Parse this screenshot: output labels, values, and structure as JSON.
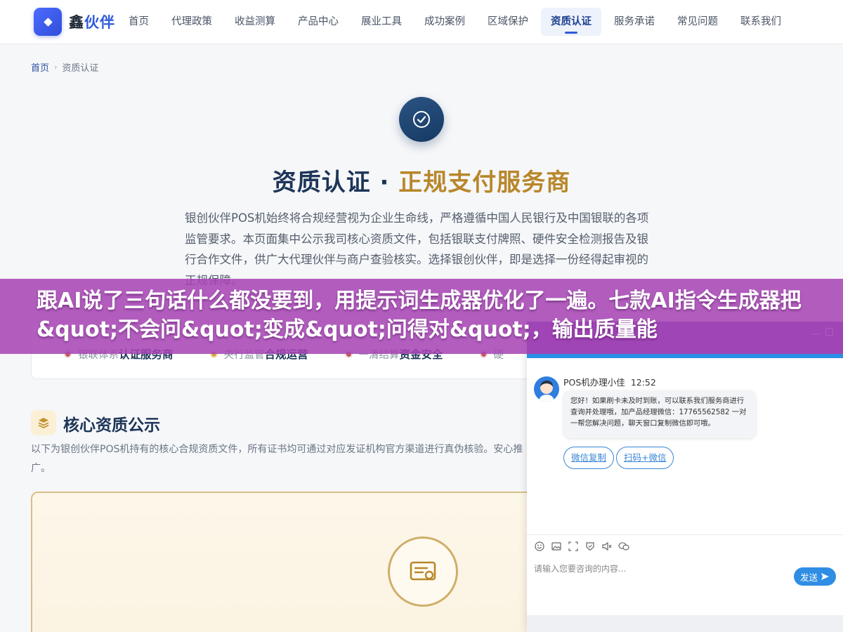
{
  "header": {
    "logo_text_a": "鑫",
    "logo_text_b": "伙伴",
    "nav": [
      "首页",
      "代理政策",
      "收益测算",
      "产品中心",
      "展业工具",
      "成功案例",
      "区域保护",
      "资质认证",
      "服务承诺",
      "常见问题",
      "联系我们"
    ],
    "active_nav": "资质认证"
  },
  "breadcrumb": {
    "home": "首页",
    "separator": "›",
    "current": "资质认证"
  },
  "hero": {
    "title_main": "资质认证 · ",
    "title_highlight": "正规支付服务商",
    "description": "银创伙伴POS机始终将合规经营视为企业生命线，严格遵循中国人民银行及中国银联的各项监管要求。本页面集中公示我司核心资质文件，包括银联支付牌照、硬件安全检测报告及银行合作文件，供广大代理伙伴与商户查验核实。选择银创伙伴，即是选择一份经得起审视的正规保障。"
  },
  "features": [
    {
      "pre": "银联体系",
      "strong": "认证服务商"
    },
    {
      "pre": "央行监管",
      "strong": "合规运营"
    },
    {
      "pre": "一清结算",
      "strong": "资金安全"
    },
    {
      "pre": "硬",
      "strong": ""
    }
  ],
  "core": {
    "title": "核心资质公示",
    "description": "以下为银创伙伴POS机持有的核心合规资质文件，所有证书均可通过对应发证机构官方渠道进行真伪核验。安心推广。"
  },
  "promo_banner": {
    "text": "跟AI说了三句话什么都没要到，用提示词生成器优化了一遍。七款AI指令生成器把&quot;不会问&quot;变成&quot;问得对&quot;，输出质量能"
  },
  "chat": {
    "minimize_label": "—",
    "agent_name": "POS机办理小佳",
    "time": "12:52",
    "message": "您好！如果刷卡未及时到账，可以联系我们服务商进行查询并处理哦，加产品经理微信：17765562582 一对一帮您解决问题，聊天窗口复制微信即可哦。",
    "quick_buttons": [
      "微信复制",
      "扫码+微信"
    ],
    "input_placeholder": "请输入您要咨询的内容...",
    "send_label": "发送",
    "colors": {
      "topbar": "#7b4fbf",
      "accent": "#2f8de4"
    }
  }
}
